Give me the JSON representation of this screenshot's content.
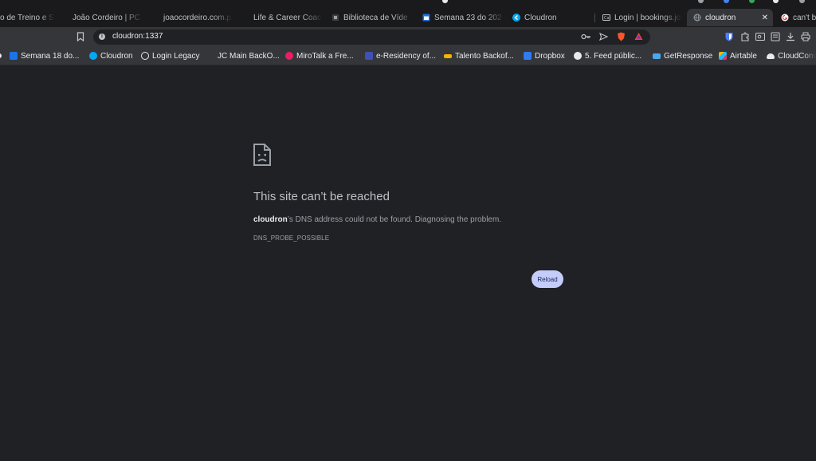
{
  "tabs": [
    {
      "label": "o de Treino e S",
      "icon": "page-icon",
      "color": "#5f6368"
    },
    {
      "label": "João Cordeiro | PC",
      "icon": "page-icon",
      "color": "#5f6368"
    },
    {
      "label": "joaocordeiro.com.p",
      "icon": "page-icon",
      "color": "#5f6368"
    },
    {
      "label": "Life & Career Coac",
      "icon": "page-icon",
      "color": "#5f6368"
    },
    {
      "label": "Biblioteca de Víde",
      "icon": "library-icon",
      "color": "#3c4043"
    },
    {
      "label": "Semana 23 do 202",
      "icon": "calendar-icon",
      "color": "#1a73e8"
    },
    {
      "label": "Cloudron",
      "icon": "cloudron-icon",
      "color": "#03a9f4"
    },
    {
      "label": "Login | bookings.jo",
      "icon": "booking-icon",
      "color": "#5f6368"
    },
    {
      "label": "cloudron",
      "icon": "globe-icon",
      "color": "#9aa0a6"
    },
    {
      "label": "can't b",
      "icon": "google-icon",
      "color": "#ea4335"
    }
  ],
  "address_bar": {
    "url": "cloudron:1337"
  },
  "bookmarks": [
    {
      "label": "Semana 18 do...",
      "icon": "calendar-icon",
      "color": "#1a73e8"
    },
    {
      "label": "Cloudron",
      "icon": "cloudron-icon",
      "color": "#03a9f4"
    },
    {
      "label": "Login Legacy",
      "icon": "globe-icon",
      "color": "#e8eaed"
    },
    {
      "label": "JC Main BackO...",
      "icon": "page-icon",
      "color": "#35363a"
    },
    {
      "label": "MiroTalk a Fre...",
      "icon": "mirotalk-icon",
      "color": "#e91e63"
    },
    {
      "label": "e-Residency of...",
      "icon": "eresidency-icon",
      "color": "#3f51b5"
    },
    {
      "label": "Talento Backof...",
      "icon": "talento-icon",
      "color": "#f4b400"
    },
    {
      "label": "Dropbox",
      "icon": "dropbox-icon",
      "color": "#2f7bf0"
    },
    {
      "label": "5. Feed públic...",
      "icon": "github-icon",
      "color": "#e8eaed"
    },
    {
      "label": "GetResponse",
      "icon": "mail-icon",
      "color": "#4aa8f0"
    },
    {
      "label": "Airtable",
      "icon": "airtable-icon",
      "color": "#fcb400"
    },
    {
      "label": "CloudConv",
      "icon": "cloudconvert-icon",
      "color": "#e8eaed"
    }
  ],
  "error": {
    "title": "This site can’t be reached",
    "host": "cloudron",
    "message": "’s DNS address could not be found. Diagnosing the problem.",
    "code": "DNS_PROBE_POSSIBLE",
    "reload_label": "Reload"
  },
  "colors": {
    "background": "#202124",
    "toolbar": "#35363a",
    "accent_button": "#c4cdf9"
  }
}
